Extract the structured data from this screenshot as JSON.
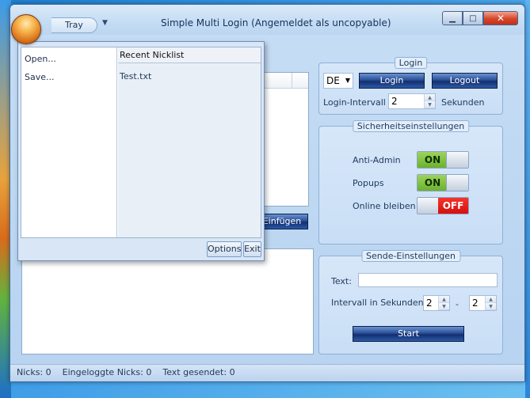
{
  "window": {
    "title": "Simple Multi Login (Angemeldet als uncopyable)",
    "tray_tab": "Tray",
    "qa_dropdown_glyph": "▼",
    "minimize_glyph": "▁",
    "maximize_glyph": "□",
    "close_glyph": "✕"
  },
  "appmenu": {
    "commands": [
      {
        "label": "Open..."
      },
      {
        "label": "Save..."
      }
    ],
    "recent_header": "Recent Nicklist",
    "recent_items": [
      "Test.txt"
    ],
    "options_label": "Options",
    "exit_label": "Exit"
  },
  "left": {
    "insert_button_label": "Einfügen"
  },
  "login": {
    "title": "Login",
    "language": "DE",
    "language_arrow": "▼",
    "login_label": "Login",
    "logout_label": "Logout",
    "interval_label": "Login-Intervall",
    "interval_value": "2",
    "seconds_label": "Sekunden"
  },
  "security": {
    "title": "Sicherheitseinstellungen",
    "anti_admin_label": "Anti-Admin",
    "anti_admin_state": "ON",
    "popups_label": "Popups",
    "popups_state": "ON",
    "online_label": "Online bleiben",
    "online_state": "OFF"
  },
  "send": {
    "title": "Sende-Einstellungen",
    "text_label": "Text:",
    "text_value": "",
    "interval_label": "Intervall in Sekunden",
    "interval_min": "2",
    "dash": "-",
    "interval_max": "2",
    "start_label": "Start"
  },
  "spin_glyphs": {
    "up": "▲",
    "down": "▼"
  },
  "status": {
    "nicks": "Nicks: 0",
    "logged_in": "Eingeloggte Nicks: 0",
    "text_sent": "Text gesendet: 0"
  },
  "colors": {
    "toggle_on": "#6ab12e",
    "toggle_off": "#d51010",
    "button_dark_blue": "#132e6e"
  }
}
